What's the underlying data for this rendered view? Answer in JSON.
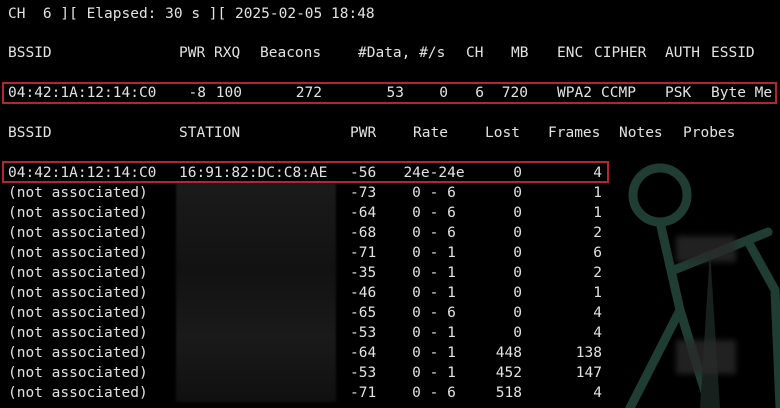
{
  "status_line": "CH  6 ][ Elapsed: 30 s ][ 2025-02-05 18:48",
  "ap_headers": {
    "bssid": "BSSID",
    "pwr": "PWR",
    "rxq": "RXQ",
    "beacons": "Beacons",
    "data": "#Data, #/s",
    "ch": "CH",
    "mb": "MB",
    "enc": "ENC",
    "cipher": "CIPHER",
    "auth": "AUTH",
    "essid": "ESSID"
  },
  "ap_rows": [
    {
      "bssid": "04:42:1A:12:14:C0",
      "pwr": "-8",
      "rxq": "100",
      "beacons": "272",
      "data": "53",
      "rate": "0",
      "ch": "6",
      "mb": "720",
      "enc": "WPA2",
      "cipher": "CCMP",
      "auth": "PSK",
      "essid": "Byte Me"
    }
  ],
  "sta_headers": {
    "bssid": "BSSID",
    "station": "STATION",
    "pwr": "PWR",
    "rate": "Rate",
    "lost": "Lost",
    "frames": "Frames",
    "notes": "Notes",
    "probes": "Probes"
  },
  "sta_rows": [
    {
      "bssid": "04:42:1A:12:14:C0",
      "station": "16:91:82:DC:C8:AE",
      "pwr": "-56",
      "rate": "24e-24e",
      "lost": "0",
      "frames": "4"
    },
    {
      "bssid": "(not associated)",
      "station": "",
      "pwr": "-73",
      "rate": "0 - 6",
      "lost": "0",
      "frames": "1"
    },
    {
      "bssid": "(not associated)",
      "station": "",
      "pwr": "-64",
      "rate": "0 - 6",
      "lost": "0",
      "frames": "1"
    },
    {
      "bssid": "(not associated)",
      "station": "",
      "pwr": "-68",
      "rate": "0 - 6",
      "lost": "0",
      "frames": "2"
    },
    {
      "bssid": "(not associated)",
      "station": "",
      "pwr": "-71",
      "rate": "0 - 1",
      "lost": "0",
      "frames": "6"
    },
    {
      "bssid": "(not associated)",
      "station": "",
      "pwr": "-35",
      "rate": "0 - 1",
      "lost": "0",
      "frames": "2"
    },
    {
      "bssid": "(not associated)",
      "station": "",
      "pwr": "-46",
      "rate": "0 - 1",
      "lost": "0",
      "frames": "1"
    },
    {
      "bssid": "(not associated)",
      "station": "",
      "pwr": "-65",
      "rate": "0 - 6",
      "lost": "0",
      "frames": "4"
    },
    {
      "bssid": "(not associated)",
      "station": "",
      "pwr": "-53",
      "rate": "0 - 1",
      "lost": "0",
      "frames": "4"
    },
    {
      "bssid": "(not associated)",
      "station": "",
      "pwr": "-64",
      "rate": "0 - 1",
      "lost": "448",
      "frames": "138"
    },
    {
      "bssid": "(not associated)",
      "station": "",
      "pwr": "-53",
      "rate": "0 - 1",
      "lost": "452",
      "frames": "147"
    },
    {
      "bssid": "(not associated)",
      "station": "",
      "pwr": "-71",
      "rate": "0 - 6",
      "lost": "518",
      "frames": "4"
    }
  ],
  "colors": {
    "background": "#000000",
    "text": "#e2e2e2",
    "highlight_box": "#b3262d",
    "logo": "#1f3d33"
  }
}
